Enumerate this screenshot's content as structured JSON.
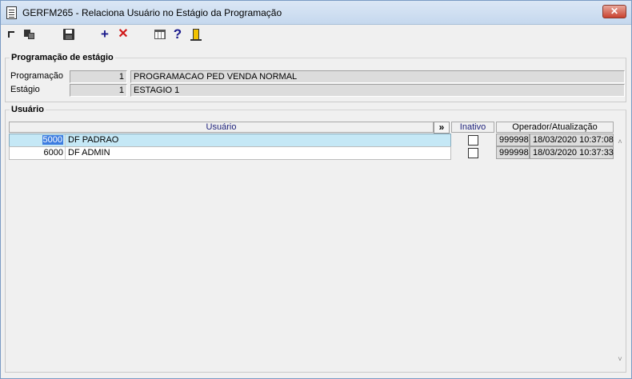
{
  "window": {
    "title": "GERFM265 - Relaciona Usuário no Estágio da Programação",
    "close_label": "✕"
  },
  "toolbar": {
    "add_label": "+",
    "delete_label": "✕",
    "help_label": "?"
  },
  "programacao_group": {
    "legend": "Programação de estágio",
    "programacao_label": "Programação",
    "programacao_code": "1",
    "programacao_desc": "PROGRAMACAO PED VENDA NORMAL",
    "estagio_label": "Estágio",
    "estagio_code": "1",
    "estagio_desc": "ESTAGIO 1"
  },
  "usuario_group": {
    "legend": "Usuário",
    "columns": {
      "usuario": "Usuário",
      "expand": "»",
      "inativo": "Inativo",
      "operador": "Operador/Atualização"
    },
    "rows": [
      {
        "id": "5000",
        "name": "DF PADRAO",
        "operator": "999998",
        "updated": "18/03/2020 10:37:08"
      },
      {
        "id": "6000",
        "name": "DF ADMIN",
        "operator": "999998",
        "updated": "18/03/2020 10:37:33"
      }
    ]
  },
  "scrollbar": {
    "up": "˄",
    "down": "˅"
  }
}
